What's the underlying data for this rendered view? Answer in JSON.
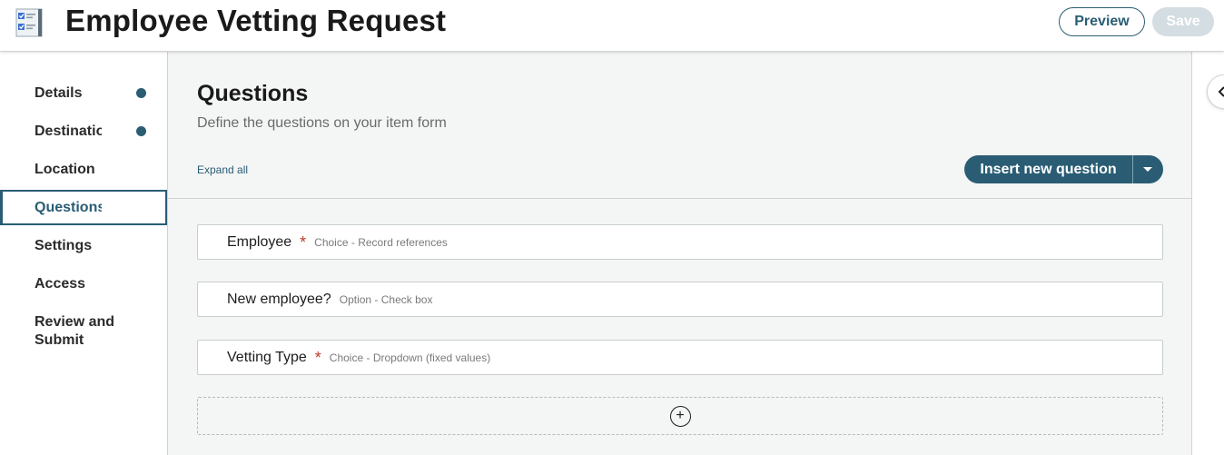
{
  "header": {
    "title": "Employee Vetting Request",
    "app_icon": "checklist-icon",
    "preview_label": "Preview",
    "save_label": "Save"
  },
  "sidebar": {
    "items": [
      {
        "label": "Details",
        "has_dot": true
      },
      {
        "label": "Destination",
        "has_dot": true
      },
      {
        "label": "Location",
        "has_dot": false
      },
      {
        "label": "Questions",
        "active": true
      },
      {
        "label": "Settings",
        "has_dot": false
      },
      {
        "label": "Access",
        "has_dot": false
      },
      {
        "label": "Review and Submit",
        "has_dot": false
      }
    ]
  },
  "main": {
    "title": "Questions",
    "subtitle": "Define the questions on your item form",
    "expand_all": "Expand all",
    "insert_label": "Insert new question",
    "questions": [
      {
        "name": "Employee",
        "required": true,
        "required_mark": "*",
        "type": "Choice - Record references"
      },
      {
        "name": "New employee?",
        "required": false,
        "type": "Option - Check box"
      },
      {
        "name": "Vetting Type",
        "required": true,
        "required_mark": "*",
        "type": "Choice - Dropdown (fixed values)"
      }
    ],
    "add_symbol": "+"
  },
  "colors": {
    "accent": "#2a5d74",
    "required": "#c0392b",
    "save_disabled": "#d3dde2"
  }
}
